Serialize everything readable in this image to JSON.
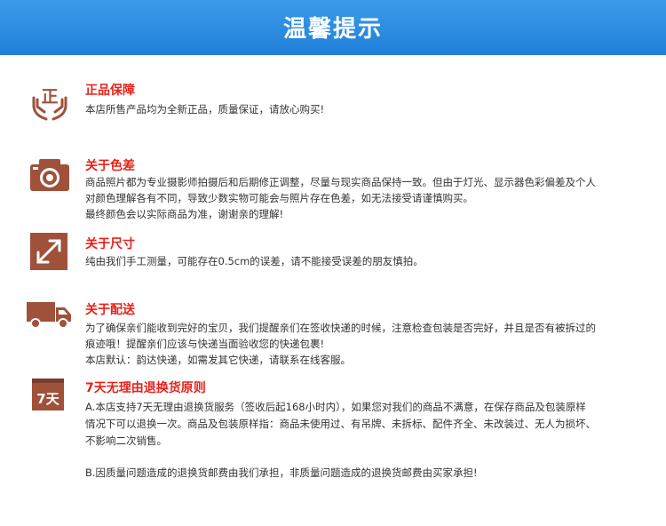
{
  "banner": {
    "title": "温馨提示"
  },
  "colors": {
    "banner": "#2d8ee3",
    "accent": "#e8211a",
    "icon": "#a0513a",
    "text": "#333333"
  },
  "sections": [
    {
      "icon": "hands-genuine-icon",
      "icon_text": "正",
      "title": "正品保障",
      "lines": [
        "本店所售产品均为全新正品，质量保证，请放心购买!"
      ]
    },
    {
      "icon": "camera-icon",
      "title": "关于色差",
      "lines": [
        "商品照片都为专业摄影师拍摄后和后期修正调整，尽量与现实商品保持一致。但由于灯光、显示器色彩偏差及个人",
        "对颜色理解各有不同，导致少数实物可能会与照片存在色差，如无法接受请谨慎购买。",
        "最终颜色会以实际商品为准，谢谢亲的理解!"
      ]
    },
    {
      "icon": "resize-arrow-icon",
      "title": "关于尺寸",
      "lines": [
        "纯由我们手工测量，可能存在0.5cm的误差，请不能接受误差的朋友慎拍。"
      ]
    },
    {
      "icon": "delivery-truck-icon",
      "title": "关于配送",
      "lines": [
        "为了确保亲们能收到完好的宝贝，我们提醒亲们在签收快递的时候，注意检查包装是否完好，并且是否有被拆过的",
        "痕迹哦！提醒亲们应该与快递当面验收您的快递包裹!",
        "本店默认：韵达快递，如需发其它快递，请联系在线客服。"
      ]
    },
    {
      "icon": "seven-day-calendar-icon",
      "icon_text": "7天",
      "title": "7天无理由退换货原则",
      "lines": [
        "A.本店支持7天无理由退换货服务（签收后起168小时内），如果您对我们的商品不满意，在保存商品及包装原样",
        "情况下可以退换一次。商品及包装原样指：商品未使用过、有吊牌、未拆标、配件齐全、未改装过、无人为损坏、",
        "不影响二次销售。",
        "B.因质量问题造成的退换货邮费由我们承担，非质量问题造成的退换货邮费由买家承担!"
      ]
    }
  ]
}
